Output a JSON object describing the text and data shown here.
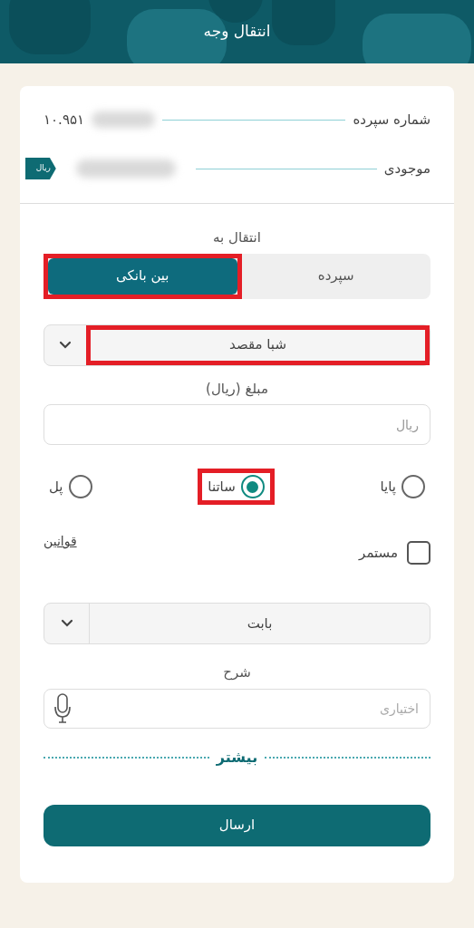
{
  "header": {
    "title": "انتقال وجه"
  },
  "account": {
    "label": "شماره سپرده",
    "value": "۱۰.۹۵۱"
  },
  "balance": {
    "label": "موجودی",
    "currency": "ریال"
  },
  "transfer_to": {
    "label": "انتقال به",
    "options": [
      {
        "label": "سپرده",
        "selected": false,
        "highlighted": false
      },
      {
        "label": "بین بانکی",
        "selected": true,
        "highlighted": true
      }
    ]
  },
  "destination_select": {
    "value": "شبا مقصد",
    "highlighted": true
  },
  "amount": {
    "label": "مبلغ (ریال)",
    "placeholder": "ریال"
  },
  "methods": [
    {
      "label": "پایا",
      "selected": false,
      "highlighted": false
    },
    {
      "label": "ساتنا",
      "selected": true,
      "highlighted": true
    },
    {
      "label": "پل",
      "selected": false,
      "highlighted": false
    }
  ],
  "recurring": {
    "label": "مستمر",
    "checked": false
  },
  "terms_link": "قوانین",
  "reason_select": {
    "value": "بابت"
  },
  "description": {
    "label": "شرح",
    "placeholder": "اختیاری"
  },
  "more": "بیشتر",
  "submit": "ارسال"
}
